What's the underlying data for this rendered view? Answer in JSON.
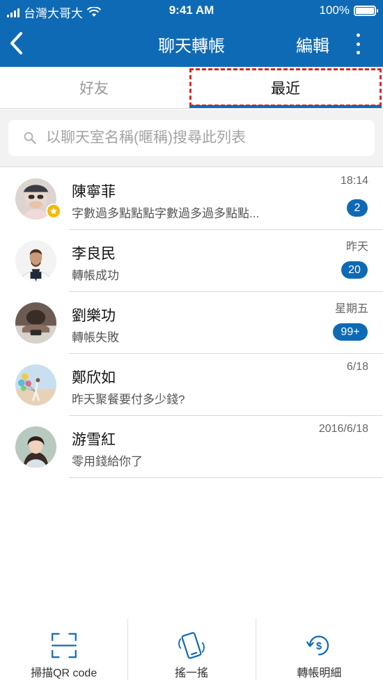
{
  "status_bar": {
    "carrier": "台灣大哥大",
    "time": "9:41 AM",
    "battery": "100%"
  },
  "nav": {
    "title": "聊天轉帳",
    "edit_label": "編輯",
    "back_icon": "chevron-left-icon",
    "more_icon": "more-vertical-icon"
  },
  "tabs": {
    "friends": "好友",
    "recent": "最近",
    "active": "recent"
  },
  "search": {
    "placeholder": "以聊天室名稱(暱稱)搜尋此列表"
  },
  "chats": [
    {
      "name": "陳寧菲",
      "preview": "字數過多點點點字數過多過多點點...",
      "time": "18:14",
      "unread": "2",
      "favorite": true
    },
    {
      "name": "李良民",
      "preview": "轉帳成功",
      "time": "昨天",
      "unread": "20",
      "favorite": false
    },
    {
      "name": "劉樂功",
      "preview": "轉帳失敗",
      "time": "星期五",
      "unread": "99+",
      "favorite": false
    },
    {
      "name": "鄭欣如",
      "preview": "昨天聚餐要付多少錢?",
      "time": "6/18",
      "unread": "",
      "favorite": false
    },
    {
      "name": "游雪紅",
      "preview": "零用錢給你了",
      "time": "2016/6/18",
      "unread": "",
      "favorite": false
    }
  ],
  "bottom_bar": {
    "scan": "掃描QR code",
    "shake": "搖一搖",
    "history": "轉帳明細"
  },
  "colors": {
    "primary": "#0f6ab5",
    "highlight_dash": "#e2231a",
    "star": "#f5b800"
  }
}
